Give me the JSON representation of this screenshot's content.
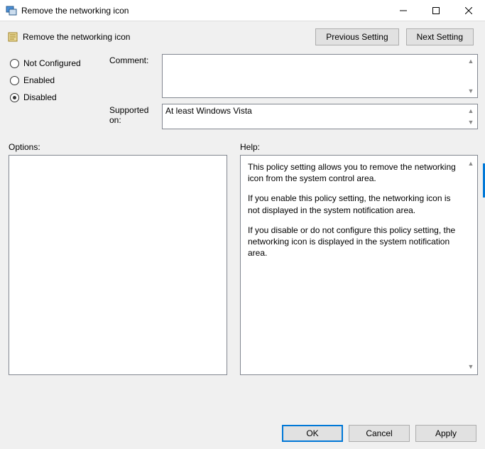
{
  "window": {
    "title": "Remove the networking icon"
  },
  "policy": {
    "name": "Remove the networking icon"
  },
  "nav": {
    "previous": "Previous Setting",
    "next": "Next Setting"
  },
  "radios": {
    "not_configured": "Not Configured",
    "enabled": "Enabled",
    "disabled": "Disabled",
    "selected": "disabled"
  },
  "comment": {
    "label": "Comment:",
    "value": ""
  },
  "supported": {
    "label": "Supported on:",
    "value": "At least Windows Vista"
  },
  "options": {
    "label": "Options:"
  },
  "help": {
    "label": "Help:",
    "p1": "This policy setting allows you to remove the networking icon from the system control area.",
    "p2": "If you enable this policy setting, the networking icon is not displayed in the system notification area.",
    "p3": "If you disable or do not configure this policy setting, the networking icon is displayed in the system notification area."
  },
  "footer": {
    "ok": "OK",
    "cancel": "Cancel",
    "apply": "Apply"
  }
}
